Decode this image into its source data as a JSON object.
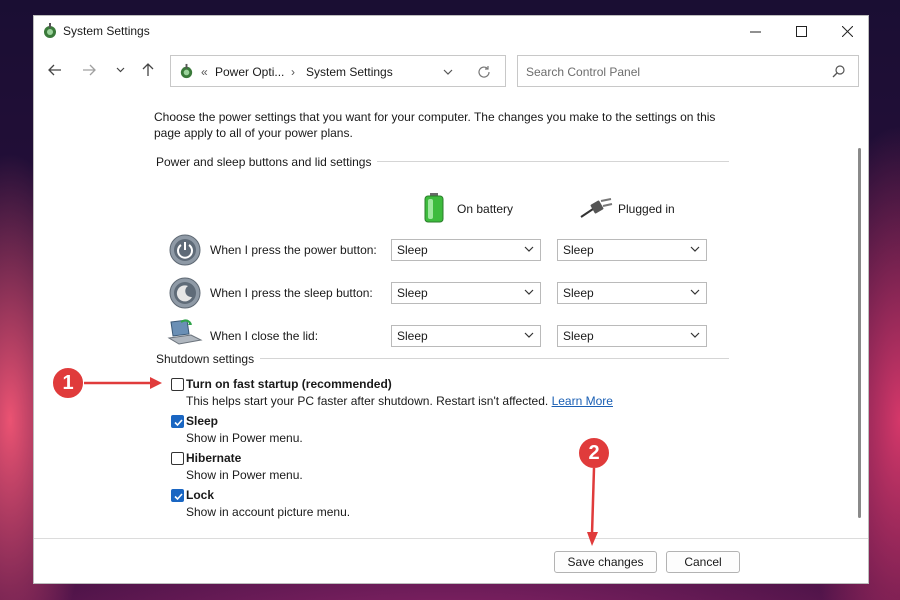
{
  "window": {
    "title": "System Settings",
    "controls": {
      "minimize": "—",
      "maximize": "☐",
      "close": "✕"
    }
  },
  "nav": {
    "back_icon": "arrow-left-icon",
    "forward_icon": "arrow-right-icon",
    "recent_icon": "chevron-down-icon",
    "up_icon": "arrow-up-icon",
    "breadcrumb": {
      "overflow": "«",
      "items": [
        "Power Opti...",
        "System Settings"
      ],
      "separator": "›"
    },
    "search_placeholder": "Search Control Panel"
  },
  "content": {
    "intro": "Choose the power settings that you want for your computer. The changes you make to the settings on this page apply to all of your power plans.",
    "power_section": {
      "title": "Power and sleep buttons and lid settings",
      "columns": [
        "On battery",
        "Plugged in"
      ],
      "rows": [
        {
          "label": "When I press the power button:",
          "battery": "Sleep",
          "plugged": "Sleep",
          "icon": "power-button-icon"
        },
        {
          "label": "When I press the sleep button:",
          "battery": "Sleep",
          "plugged": "Sleep",
          "icon": "sleep-button-icon"
        },
        {
          "label": "When I close the lid:",
          "battery": "Sleep",
          "plugged": "Sleep",
          "icon": "laptop-lid-icon"
        }
      ]
    },
    "shutdown_section": {
      "title": "Shutdown settings",
      "options": [
        {
          "label": "Turn on fast startup (recommended)",
          "desc": "This helps start your PC faster after shutdown. Restart isn't affected.",
          "link": "Learn More",
          "checked": false
        },
        {
          "label": "Sleep",
          "desc": "Show in Power menu.",
          "checked": true
        },
        {
          "label": "Hibernate",
          "desc": "Show in Power menu.",
          "checked": false
        },
        {
          "label": "Lock",
          "desc": "Show in account picture menu.",
          "checked": true
        }
      ]
    }
  },
  "footer": {
    "save": "Save changes",
    "cancel": "Cancel"
  },
  "annotations": [
    {
      "number": "1"
    },
    {
      "number": "2"
    }
  ],
  "colors": {
    "accent": "#1a66c2",
    "link": "#1a5fb4",
    "annotation": "#e03b3b",
    "battery_green": "#3dbb3d"
  }
}
